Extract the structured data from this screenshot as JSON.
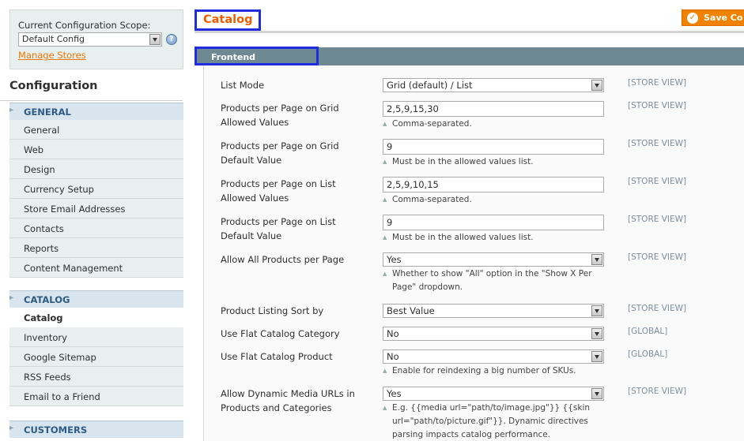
{
  "sidebar": {
    "scope_label": "Current Configuration Scope:",
    "scope_value": "Default Config",
    "manage_stores": "Manage Stores",
    "title": "Configuration",
    "sections": [
      {
        "label": "GENERAL",
        "items": [
          "General",
          "Web",
          "Design",
          "Currency Setup",
          "Store Email Addresses",
          "Contacts",
          "Reports",
          "Content Management"
        ]
      },
      {
        "label": "CATALOG",
        "items": [
          "Catalog",
          "Inventory",
          "Google Sitemap",
          "RSS Feeds",
          "Email to a Friend"
        ],
        "active": "Catalog"
      },
      {
        "label": "CUSTOMERS",
        "items": []
      }
    ]
  },
  "header": {
    "title": "Catalog",
    "save_label": "Save Co"
  },
  "section": {
    "label": "Frontend"
  },
  "fields": [
    {
      "label": "List Mode",
      "type": "select",
      "value": "Grid (default) / List",
      "scope": "[STORE VIEW]"
    },
    {
      "label": "Products per Page on Grid Allowed Values",
      "type": "input",
      "value": "2,5,9,15,30",
      "note": "Comma-separated.",
      "scope": "[STORE VIEW]"
    },
    {
      "label": "Products per Page on Grid Default Value",
      "type": "input",
      "value": "9",
      "note": "Must be in the allowed values list.",
      "scope": "[STORE VIEW]"
    },
    {
      "label": "Products per Page on List Allowed Values",
      "type": "input",
      "value": "2,5,9,10,15",
      "note": "Comma-separated.",
      "scope": "[STORE VIEW]"
    },
    {
      "label": "Products per Page on List Default Value",
      "type": "input",
      "value": "9",
      "note": "Must be in the allowed values list.",
      "scope": "[STORE VIEW]"
    },
    {
      "label": "Allow All Products per Page",
      "type": "select",
      "value": "Yes",
      "note": "Whether to show \"All\" option in the \"Show X Per Page\" dropdown.",
      "scope": "[STORE VIEW]"
    },
    {
      "label": "Product Listing Sort by",
      "type": "select",
      "value": "Best Value",
      "scope": "[STORE VIEW]"
    },
    {
      "label": "Use Flat Catalog Category",
      "type": "select",
      "value": "No",
      "scope": "[GLOBAL]"
    },
    {
      "label": "Use Flat Catalog Product",
      "type": "select",
      "value": "No",
      "note": "Enable for reindexing a big number of SKUs.",
      "scope": "[GLOBAL]"
    },
    {
      "label": "Allow Dynamic Media URLs in Products and Categories",
      "type": "select",
      "value": "Yes",
      "note": "E.g. {{media url=\"path/to/image.jpg\"}} {{skin url=\"path/to/picture.gif\"}}. Dynamic directives parsing impacts catalog performance.",
      "scope": "[STORE VIEW]"
    }
  ],
  "colors": {
    "accent": "#eb5e00",
    "save": "#f18200",
    "section": "#6f8992",
    "nav_section": "#2d5b83",
    "highlight_box": "#1f2de0"
  },
  "icons": {
    "help": "help-icon",
    "save": "save-check-icon",
    "select": "chevron-down-icon"
  }
}
